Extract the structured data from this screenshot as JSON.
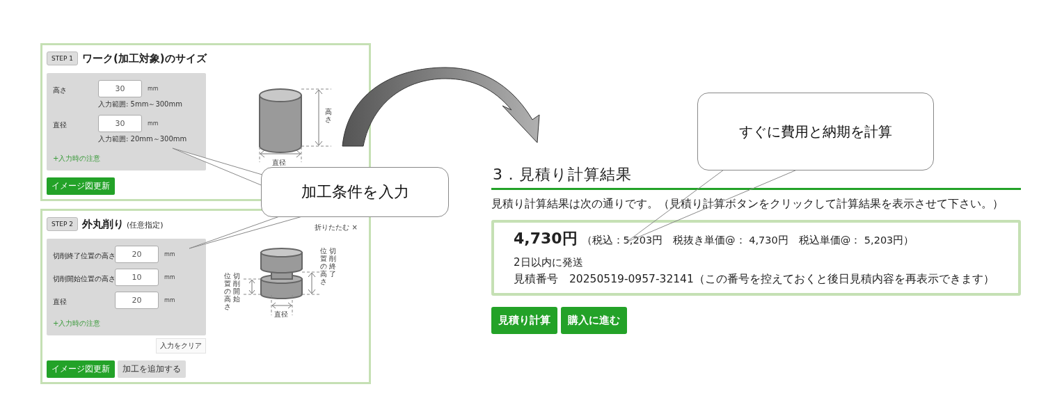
{
  "steps": [
    {
      "badge": "STEP 1",
      "title": "ワーク(加工対象)のサイズ",
      "fields": [
        {
          "label": "高さ",
          "value": "30",
          "unit": "mm",
          "hint": "入力範囲: 5mm～300mm"
        },
        {
          "label": "直径",
          "value": "30",
          "unit": "mm",
          "hint": "入力範囲: 20mm～300mm"
        }
      ],
      "note": "+入力時の注意",
      "diagram": {
        "kind": "cylinder",
        "labels": [
          [
            "高さ"
          ],
          [
            "直径"
          ]
        ]
      },
      "buttons": [
        {
          "label": "イメージ図更新",
          "kind": "primary"
        }
      ]
    },
    {
      "badge": "STEP 2",
      "title": "外丸削り",
      "subtitle": "(任意指定)",
      "collapse": "折りたたむ ×",
      "fields": [
        {
          "label": "切削終了位置の高さ",
          "value": "20",
          "unit": "mm"
        },
        {
          "label": "切削開始位置の高さ",
          "value": "10",
          "unit": "mm"
        },
        {
          "label": "直径",
          "value": "20",
          "unit": "mm"
        }
      ],
      "note": "+入力時の注意",
      "clear": "入力をクリア",
      "diagram": {
        "kind": "stepped",
        "labels": [
          [
            "位置の高さ",
            "切削終了"
          ],
          [
            "位置の高さ",
            "切削開始"
          ],
          [
            "直径"
          ]
        ]
      },
      "buttons": [
        {
          "label": "イメージ図更新",
          "kind": "primary"
        },
        {
          "label": "加工を追加する",
          "kind": "secondary"
        }
      ]
    }
  ],
  "result": {
    "heading": "3．見積り計算結果",
    "description": "見積り計算結果は次の通りです。（見積り計算ボタンをクリックして計算結果を表示させて下さい。）",
    "price": "4,730円",
    "price_detail": "（税込：5,203円　税抜き単価@： 4,730円　税込単価@： 5,203円）",
    "shipping": "2日以内に発送",
    "estimate": "見積番号　20250519-0957-32141（この番号を控えておくと後日見積内容を再表示できます）",
    "buttons": [
      {
        "label": "見積り計算",
        "kind": "primary"
      },
      {
        "label": "購入に進む",
        "kind": "primary"
      }
    ]
  },
  "callouts": [
    {
      "text": "加工条件を入力"
    },
    {
      "text": "すぐに費用と納期を計算"
    }
  ]
}
